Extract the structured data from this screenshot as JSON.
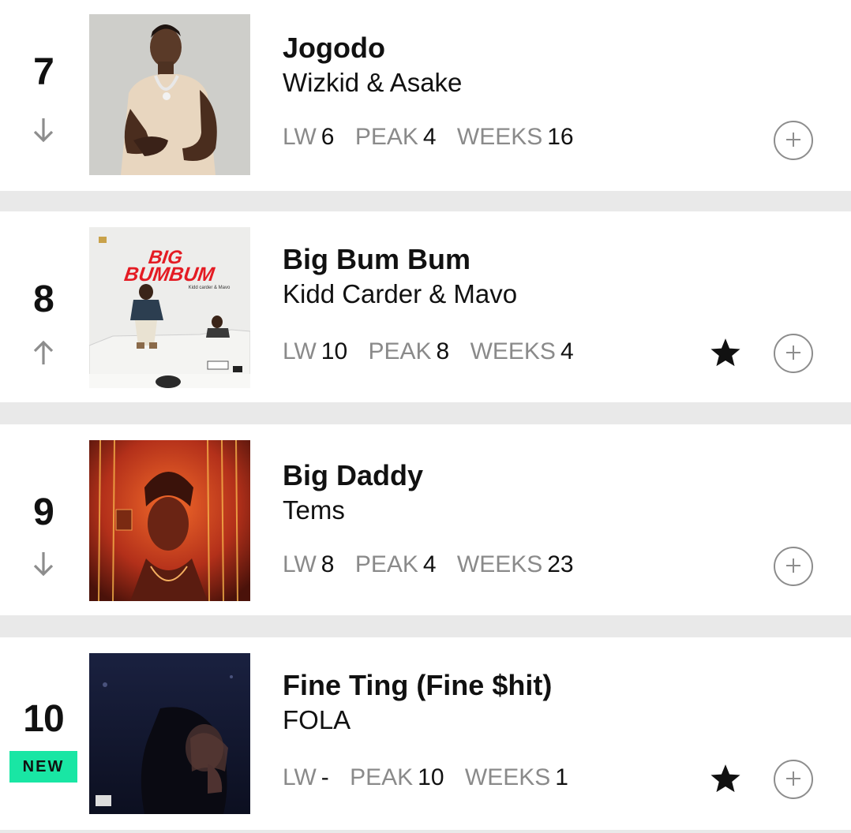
{
  "chart": {
    "entries": [
      {
        "rank": "7",
        "trend": "down",
        "title": "Jogodo",
        "artist": "Wizkid & Asake",
        "lw_label": "LW",
        "lw": "6",
        "peak_label": "PEAK",
        "peak": "4",
        "weeks_label": "WEEKS",
        "weeks": "16",
        "award": false
      },
      {
        "rank": "8",
        "trend": "up",
        "title": "Big Bum Bum",
        "artist": "Kidd Carder & Mavo",
        "lw_label": "LW",
        "lw": "10",
        "peak_label": "PEAK",
        "peak": "8",
        "weeks_label": "WEEKS",
        "weeks": "4",
        "award": true,
        "cover_text": {
          "line1": "BIG",
          "line2": "BUMBUM",
          "credit": "Kidd carder & Mavo"
        }
      },
      {
        "rank": "9",
        "trend": "down",
        "title": "Big Daddy",
        "artist": "Tems",
        "lw_label": "LW",
        "lw": "8",
        "peak_label": "PEAK",
        "peak": "4",
        "weeks_label": "WEEKS",
        "weeks": "23",
        "award": false
      },
      {
        "rank": "10",
        "trend": "new",
        "new_label": "NEW",
        "title": "Fine Ting (Fine $hit)",
        "artist": "FOLA",
        "lw_label": "LW",
        "lw": "-",
        "peak_label": "PEAK",
        "peak": "10",
        "weeks_label": "WEEKS",
        "weeks": "1",
        "award": true
      }
    ]
  },
  "colors": {
    "background": "#e9e9e9",
    "row": "#ffffff",
    "label_gray": "#8a8a8a",
    "trend_gray": "#8d8d8d",
    "new_badge": "#19e6a4",
    "cover_red_text": "#e41b23"
  },
  "icons": {
    "trend_down": "arrow-down-icon",
    "trend_up": "arrow-up-icon",
    "award": "star-icon",
    "add": "plus-circle-icon"
  }
}
